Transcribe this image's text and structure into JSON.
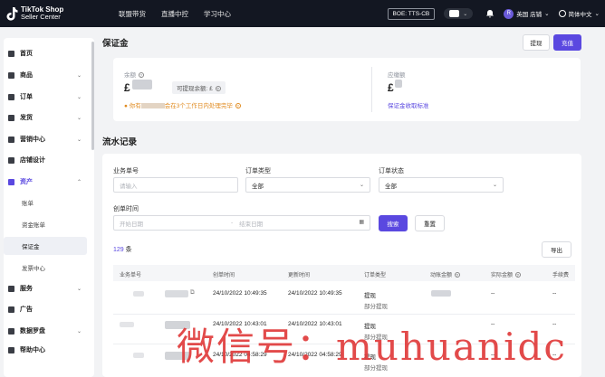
{
  "topbar": {
    "logo_line1": "TikTok Shop",
    "logo_line2": "Seller Center",
    "nav": [
      "联盟带货",
      "直播中控",
      "学习中心"
    ],
    "env_badge": "BOE: TTS-CB",
    "shop_avatar": "R",
    "shop_name": "英国 店铺",
    "language": "简体中文"
  },
  "sidebar": {
    "items": [
      {
        "label": "首页",
        "icon": "home-icon"
      },
      {
        "label": "商品",
        "icon": "product-icon"
      },
      {
        "label": "订单",
        "icon": "order-icon"
      },
      {
        "label": "发货",
        "icon": "shipping-icon"
      },
      {
        "label": "营销中心",
        "icon": "marketing-icon"
      },
      {
        "label": "店铺设计",
        "icon": "store-design-icon"
      },
      {
        "label": "资产",
        "icon": "assets-icon"
      },
      {
        "label": "服务",
        "icon": "service-icon"
      },
      {
        "label": "广告",
        "icon": "ads-icon"
      },
      {
        "label": "数据罗盘",
        "icon": "data-compass-icon"
      },
      {
        "label": "帮助中心",
        "icon": "help-icon"
      }
    ],
    "sub_items": [
      "账单",
      "资金账单",
      "保证金",
      "发票中心"
    ]
  },
  "deposit": {
    "title": "保证金",
    "withdraw_btn": "提现",
    "recharge_btn": "充值",
    "balance_label": "余额",
    "balance_currency": "£",
    "withdrawable_label": "可提现余额: £",
    "notice_prefix": "你有",
    "notice_suffix": "会在3个工作日内处理完毕",
    "due_label": "应缴额",
    "due_currency": "£",
    "rules_link": "保证金收取标准"
  },
  "records": {
    "title": "流水记录",
    "filters": {
      "order_no_label": "业务单号",
      "order_no_placeholder": "请输入",
      "order_type_label": "订单类型",
      "order_type_value": "全部",
      "order_status_label": "订单状态",
      "order_status_value": "全部",
      "created_label": "创单时间",
      "start_placeholder": "开始日期",
      "range_sep": "-",
      "end_placeholder": "结束日期",
      "search_btn": "搜索",
      "reset_btn": "重置"
    },
    "count": "129",
    "count_unit": "条",
    "export_btn": "导出",
    "columns": [
      "业务单号",
      "创单时间",
      "更新时间",
      "订单类型",
      "动账金额",
      "实际金额",
      "手续费"
    ],
    "rows": [
      {
        "created": "24/10/2022 10:49:35",
        "updated": "24/10/2022 10:49:35",
        "type": "提现",
        "status": "部分提现",
        "actual": "--",
        "fee": "--"
      },
      {
        "created": "24/10/2022 10:43:01",
        "updated": "24/10/2022 10:43:01",
        "type": "提现",
        "status": "部分提现",
        "actual": "--",
        "fee": "--"
      },
      {
        "created": "24/10/2022 04:58:29",
        "updated": "24/10/2022 04:58:29",
        "type": "提现",
        "status": "部分提现",
        "actual": "--",
        "fee": "--"
      }
    ]
  },
  "watermark": "微信号：muhuanidc",
  "colors": {
    "accent": "#5a48e0",
    "warning": "#e08a1e",
    "topbar": "#131722"
  }
}
